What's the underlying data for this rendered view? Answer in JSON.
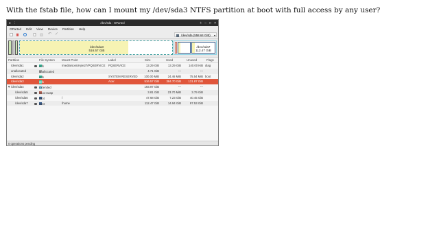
{
  "question": "With the fstab file, how can I mount my /dev/sda3 NTFS partition at boot with full access by any user?",
  "window": {
    "title": "/dev/sda - GParted",
    "controls": [
      "+",
      "–",
      "□",
      "×"
    ]
  },
  "menu": [
    "GParted",
    "Edit",
    "View",
    "Device",
    "Partition",
    "Help"
  ],
  "toolbar": {
    "icons": [
      "new-icon",
      "delete-icon",
      "resize-icon",
      "copy-icon",
      "paste-icon",
      "undo-icon",
      "apply-icon"
    ],
    "device_selector": "/dev/sda  (558.64 GiB)"
  },
  "partition_map": {
    "sda3_name": "/dev/sda3",
    "sda3_size": "516.57 GiB",
    "sda7_name": "/dev/sda7",
    "sda7_size": "112.47 GiB"
  },
  "columns": [
    "Partition",
    "File System",
    "Mount Point",
    "Label",
    "Size",
    "Used",
    "Unused",
    "Flags"
  ],
  "rows": [
    {
      "partition": "/dev/sda1",
      "fs": "ntfs",
      "color": "#42c8a8",
      "mount": "/media/sonicKyle27/PQSERVICE",
      "label": "PQSERVICE",
      "size": "13.29 GiB",
      "used": "13.29 GiB",
      "unused": "140.00 KiB",
      "flags": "diag",
      "locked": true,
      "indent": false
    },
    {
      "partition": "unallocated",
      "fs": "unallocated",
      "color": "#a9a9a9",
      "mount": "",
      "label": "",
      "size": "4.71 GiB",
      "used": "---",
      "unused": "---",
      "flags": "",
      "locked": false,
      "indent": false
    },
    {
      "partition": "/dev/sda2",
      "fs": "ntfs",
      "color": "#42c8a8",
      "mount": "",
      "label": "SYSTEM RESERVED",
      "size": "100.00 MiB",
      "used": "24.46 MiB",
      "unused": "75.54 MiB",
      "flags": "boot",
      "locked": false,
      "indent": false
    },
    {
      "partition": "/dev/sda3",
      "fs": "ntfs",
      "color": "#42c8a8",
      "mount": "",
      "label": "Acer",
      "size": "516.57 GiB",
      "used": "384.70 GiB",
      "unused": "131.87 GiB",
      "flags": "",
      "locked": false,
      "indent": false
    },
    {
      "partition": "/dev/sda4",
      "fs": "extended",
      "color": "#8fd4e6",
      "mount": "",
      "label": "",
      "size": "193.97 GiB",
      "used": "---",
      "unused": "---",
      "flags": "",
      "locked": true,
      "indent": false
    },
    {
      "partition": "/dev/sda5",
      "fs": "linux-swap",
      "color": "#c86b5a",
      "mount": "",
      "label": "",
      "size": "3.81 GiB",
      "used": "23.70 MiB",
      "unused": "3.79 GiB",
      "flags": "",
      "locked": true,
      "indent": true
    },
    {
      "partition": "/dev/sda6",
      "fs": "ext4",
      "color": "#3a5f8f",
      "mount": "/",
      "label": "",
      "size": "47.68 GiB",
      "used": "7.23 GiB",
      "unused": "40.45 GiB",
      "flags": "",
      "locked": true,
      "indent": true
    },
    {
      "partition": "/dev/sda7",
      "fs": "ext4",
      "color": "#3a5f8f",
      "mount": "/home",
      "label": "",
      "size": "112.47 GiB",
      "used": "14.94 GiB",
      "unused": "97.53 GiB",
      "flags": "",
      "locked": true,
      "indent": true
    }
  ],
  "selected_partition": "/dev/sda3",
  "status": "0 operations pending"
}
